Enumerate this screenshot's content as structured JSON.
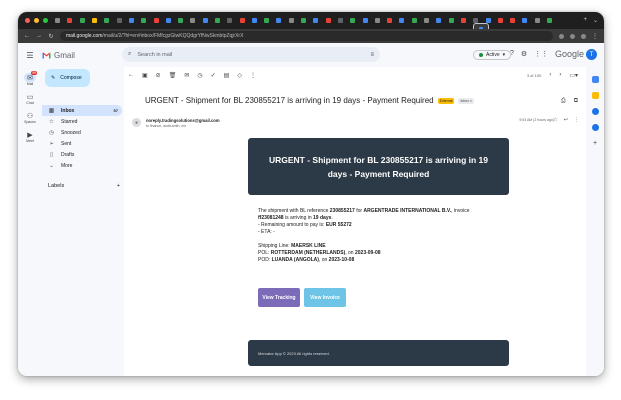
{
  "browser": {
    "url_host": "mail.google.com",
    "url_rest": "/mail/u/2/?hl=en#inbox/FMfcgzGtwKQQdgrYfNwSkmbtpZqjrXrX",
    "traffic_lights": [
      "#ff5f57",
      "#febc2e",
      "#28c840"
    ]
  },
  "gmail": {
    "logo_text": "Gmail",
    "search_placeholder": "Search in mail",
    "status": "Active",
    "google_text": "Google",
    "avatar_letter": "T",
    "compose_label": "Compose",
    "rail": [
      {
        "label": "Mail",
        "icon": "mail-icon",
        "badge": "99"
      },
      {
        "label": "Chat",
        "icon": "chat-icon"
      },
      {
        "label": "Spaces",
        "icon": "spaces-icon"
      },
      {
        "label": "Meet",
        "icon": "meet-icon"
      }
    ],
    "nav": [
      {
        "label": "Inbox",
        "icon": "inbox-icon",
        "count": "57"
      },
      {
        "label": "Starred",
        "icon": "star-icon"
      },
      {
        "label": "Snoozed",
        "icon": "clock-icon"
      },
      {
        "label": "Sent",
        "icon": "send-icon"
      },
      {
        "label": "Drafts",
        "icon": "draft-icon"
      },
      {
        "label": "More",
        "icon": "chevron-down-icon"
      }
    ],
    "labels_title": "Labels",
    "pagination": "3 of 100"
  },
  "email": {
    "subject": "URGENT - Shipment for BL 230855217 is arriving in 19 days - Payment Required",
    "tag_external": "External",
    "tag_inbox": "Inbox",
    "from": "noreply.tradingsolutions@gmail.com",
    "to": "to finance, audit-smth, me",
    "time": "9:53 AM (2 hours ago)",
    "banner": "URGENT - Shipment for BL 230855217 is arriving in 19 days - Payment Required",
    "line1_a": "The shipment with BL reference ",
    "line1_bl": "230855217",
    "line1_b": " for ",
    "line1_company": "ARGENTRADE INTERNATIONAL B.V.",
    "line1_c": ", invoice",
    "line2_invoice": "ff23081248",
    "line2_a": " is arriving in ",
    "line2_days": "19 days",
    "line3_a": "- Remaining amount to pay is: ",
    "line3_amount": "EUR 55272",
    "line4": "- ETA: -",
    "shipping_a": "Shipping Line: ",
    "shipping_line": "MAERSK LINE",
    "pol_a": "POL: ",
    "pol": "ROTTERDAM (NETHERLANDS)",
    "pol_b": ", on ",
    "pol_date": "2023-09-08",
    "pod_a": "POD: ",
    "pod": "LUANDA (ANGOLA)",
    "pod_b": ", on ",
    "pod_date": "2023-10-08",
    "btn_tracking": "View Tracking",
    "btn_invoice": "View Invoice",
    "footer": "Mercator App © 2023 All rights reserved."
  },
  "colors": {
    "banner_bg": "#2c3946",
    "btn_tracking": "#7b6bb8",
    "btn_invoice": "#6ec4e6",
    "tag_external": "#fbbc04",
    "gmail_accent": "#c2e7ff"
  }
}
